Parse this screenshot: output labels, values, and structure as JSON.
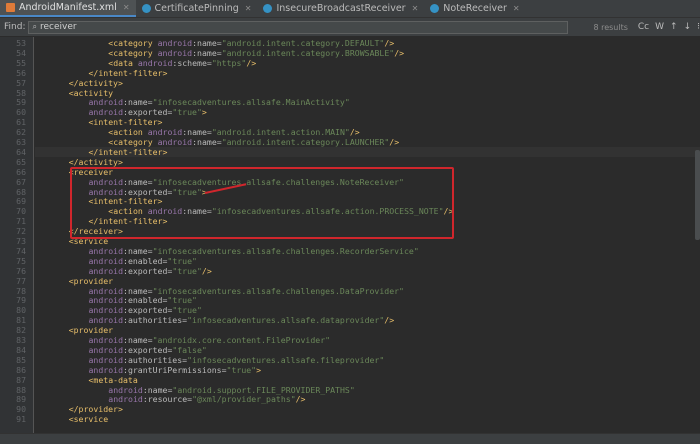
{
  "tabs": [
    {
      "label": "AndroidManifest.xml",
      "icon": "xml-file-icon",
      "active": true
    },
    {
      "label": "CertificatePinning",
      "icon": "class-icon",
      "active": false
    },
    {
      "label": "InsecureBroadcastReceiver",
      "icon": "class-icon",
      "active": false
    },
    {
      "label": "NoteReceiver",
      "icon": "class-icon",
      "active": false
    }
  ],
  "find": {
    "label": "Find:",
    "query": "receiver",
    "results": "8 results",
    "options": [
      "Cc",
      "W",
      "↑",
      "↓",
      "⁝"
    ]
  },
  "lines": [
    {
      "n": "53",
      "ind": 7,
      "seg": [
        [
          "t",
          "<category "
        ],
        [
          "n",
          "android"
        ],
        [
          "a",
          ":name="
        ],
        [
          "v",
          "\"android.intent.category.DEFAULT\""
        ],
        [
          "t",
          "/>"
        ]
      ]
    },
    {
      "n": "54",
      "ind": 7,
      "seg": [
        [
          "t",
          "<category "
        ],
        [
          "n",
          "android"
        ],
        [
          "a",
          ":name="
        ],
        [
          "v",
          "\"android.intent.category.BROWSABLE\""
        ],
        [
          "t",
          "/>"
        ]
      ]
    },
    {
      "n": "55",
      "ind": 7,
      "seg": [
        [
          "t",
          "<data "
        ],
        [
          "n",
          "android"
        ],
        [
          "a",
          ":scheme="
        ],
        [
          "v",
          "\"https\""
        ],
        [
          "t",
          "/>"
        ]
      ]
    },
    {
      "n": "56",
      "ind": 5,
      "seg": [
        [
          "t",
          "</intent-filter>"
        ]
      ]
    },
    {
      "n": "57",
      "ind": 3,
      "seg": [
        [
          "t",
          "</activity>"
        ]
      ]
    },
    {
      "n": "58",
      "ind": 3,
      "seg": [
        [
          "t",
          "<activity"
        ]
      ]
    },
    {
      "n": "59",
      "ind": 5,
      "seg": [
        [
          "n",
          "android"
        ],
        [
          "a",
          ":name="
        ],
        [
          "v",
          "\"infosecadventures.allsafe.MainActivity\""
        ]
      ]
    },
    {
      "n": "60",
      "ind": 5,
      "seg": [
        [
          "n",
          "android"
        ],
        [
          "a",
          ":exported="
        ],
        [
          "v",
          "\"true\""
        ],
        [
          "t",
          ">"
        ]
      ]
    },
    {
      "n": "61",
      "ind": 5,
      "seg": [
        [
          "t",
          "<intent-filter>"
        ]
      ]
    },
    {
      "n": "62",
      "ind": 7,
      "seg": [
        [
          "t",
          "<action "
        ],
        [
          "n",
          "android"
        ],
        [
          "a",
          ":name="
        ],
        [
          "v",
          "\"android.intent.action.MAIN\""
        ],
        [
          "t",
          "/>"
        ]
      ]
    },
    {
      "n": "63",
      "ind": 7,
      "seg": [
        [
          "t",
          "<category "
        ],
        [
          "n",
          "android"
        ],
        [
          "a",
          ":name="
        ],
        [
          "v",
          "\"android.intent.category.LAUNCHER\""
        ],
        [
          "t",
          "/>"
        ]
      ]
    },
    {
      "n": "64",
      "ind": 5,
      "seg": [
        [
          "t",
          "</intent-filter>"
        ]
      ],
      "caret": true
    },
    {
      "n": "65",
      "ind": 3,
      "seg": [
        [
          "t",
          "</activity>"
        ]
      ]
    },
    {
      "n": "66",
      "ind": 3,
      "seg": [
        [
          "t",
          "<receiver"
        ]
      ]
    },
    {
      "n": "67",
      "ind": 5,
      "seg": [
        [
          "n",
          "android"
        ],
        [
          "a",
          ":name="
        ],
        [
          "v",
          "\"infosecadventures.allsafe.challenges.NoteReceiver\""
        ]
      ]
    },
    {
      "n": "68",
      "ind": 5,
      "seg": [
        [
          "n",
          "android"
        ],
        [
          "a",
          ":exported="
        ],
        [
          "v",
          "\"true\""
        ],
        [
          "t",
          ">"
        ]
      ]
    },
    {
      "n": "69",
      "ind": 5,
      "seg": [
        [
          "t",
          "<intent-filter>"
        ]
      ]
    },
    {
      "n": "70",
      "ind": 7,
      "seg": [
        [
          "t",
          "<action "
        ],
        [
          "n",
          "android"
        ],
        [
          "a",
          ":name="
        ],
        [
          "v",
          "\"infosecadventures.allsafe.action.PROCESS_NOTE\""
        ],
        [
          "t",
          "/>"
        ]
      ]
    },
    {
      "n": "71",
      "ind": 5,
      "seg": [
        [
          "t",
          "</intent-filter>"
        ]
      ]
    },
    {
      "n": "72",
      "ind": 3,
      "seg": [
        [
          "t",
          "</receiver>"
        ]
      ]
    },
    {
      "n": "73",
      "ind": 3,
      "seg": [
        [
          "t",
          "<service"
        ]
      ]
    },
    {
      "n": "74",
      "ind": 5,
      "seg": [
        [
          "n",
          "android"
        ],
        [
          "a",
          ":name="
        ],
        [
          "v",
          "\"infosecadventures.allsafe.challenges.RecorderService\""
        ]
      ]
    },
    {
      "n": "75",
      "ind": 5,
      "seg": [
        [
          "n",
          "android"
        ],
        [
          "a",
          ":enabled="
        ],
        [
          "v",
          "\"true\""
        ]
      ]
    },
    {
      "n": "76",
      "ind": 5,
      "seg": [
        [
          "n",
          "android"
        ],
        [
          "a",
          ":exported="
        ],
        [
          "v",
          "\"true\""
        ],
        [
          "t",
          "/>"
        ]
      ]
    },
    {
      "n": "77",
      "ind": 3,
      "seg": [
        [
          "t",
          "<provider"
        ]
      ]
    },
    {
      "n": "78",
      "ind": 5,
      "seg": [
        [
          "n",
          "android"
        ],
        [
          "a",
          ":name="
        ],
        [
          "v",
          "\"infosecadventures.allsafe.challenges.DataProvider\""
        ]
      ]
    },
    {
      "n": "79",
      "ind": 5,
      "seg": [
        [
          "n",
          "android"
        ],
        [
          "a",
          ":enabled="
        ],
        [
          "v",
          "\"true\""
        ]
      ]
    },
    {
      "n": "80",
      "ind": 5,
      "seg": [
        [
          "n",
          "android"
        ],
        [
          "a",
          ":exported="
        ],
        [
          "v",
          "\"true\""
        ]
      ]
    },
    {
      "n": "81",
      "ind": 5,
      "seg": [
        [
          "n",
          "android"
        ],
        [
          "a",
          ":authorities="
        ],
        [
          "v",
          "\"infosecadventures.allsafe.dataprovider\""
        ],
        [
          "t",
          "/>"
        ]
      ]
    },
    {
      "n": "82",
      "ind": 3,
      "seg": [
        [
          "t",
          "<provider"
        ]
      ]
    },
    {
      "n": "83",
      "ind": 5,
      "seg": [
        [
          "n",
          "android"
        ],
        [
          "a",
          ":name="
        ],
        [
          "v",
          "\"androidx.core.content.FileProvider\""
        ]
      ]
    },
    {
      "n": "84",
      "ind": 5,
      "seg": [
        [
          "n",
          "android"
        ],
        [
          "a",
          ":exported="
        ],
        [
          "v",
          "\"false\""
        ]
      ]
    },
    {
      "n": "85",
      "ind": 5,
      "seg": [
        [
          "n",
          "android"
        ],
        [
          "a",
          ":authorities="
        ],
        [
          "v",
          "\"infosecadventures.allsafe.fileprovider\""
        ]
      ]
    },
    {
      "n": "86",
      "ind": 5,
      "seg": [
        [
          "n",
          "android"
        ],
        [
          "a",
          ":grantUriPermissions="
        ],
        [
          "v",
          "\"true\""
        ],
        [
          "t",
          ">"
        ]
      ]
    },
    {
      "n": "87",
      "ind": 5,
      "seg": [
        [
          "t",
          "<meta-data"
        ]
      ]
    },
    {
      "n": "88",
      "ind": 7,
      "seg": [
        [
          "n",
          "android"
        ],
        [
          "a",
          ":name="
        ],
        [
          "v",
          "\"android.support.FILE_PROVIDER_PATHS\""
        ]
      ]
    },
    {
      "n": "89",
      "ind": 7,
      "seg": [
        [
          "n",
          "android"
        ],
        [
          "a",
          ":resource="
        ],
        [
          "v",
          "\"@xml/provider_paths\""
        ],
        [
          "t",
          "/>"
        ]
      ]
    },
    {
      "n": "90",
      "ind": 3,
      "seg": [
        [
          "t",
          "</provider>"
        ]
      ]
    },
    {
      "n": "91",
      "ind": 3,
      "seg": [
        [
          "t",
          "<service"
        ]
      ]
    }
  ],
  "colors": {
    "tag": "#e8bf6a",
    "namespace": "#9876aa",
    "attribute": "#bababa",
    "value": "#6a8759",
    "highlight": "#d0262c"
  }
}
